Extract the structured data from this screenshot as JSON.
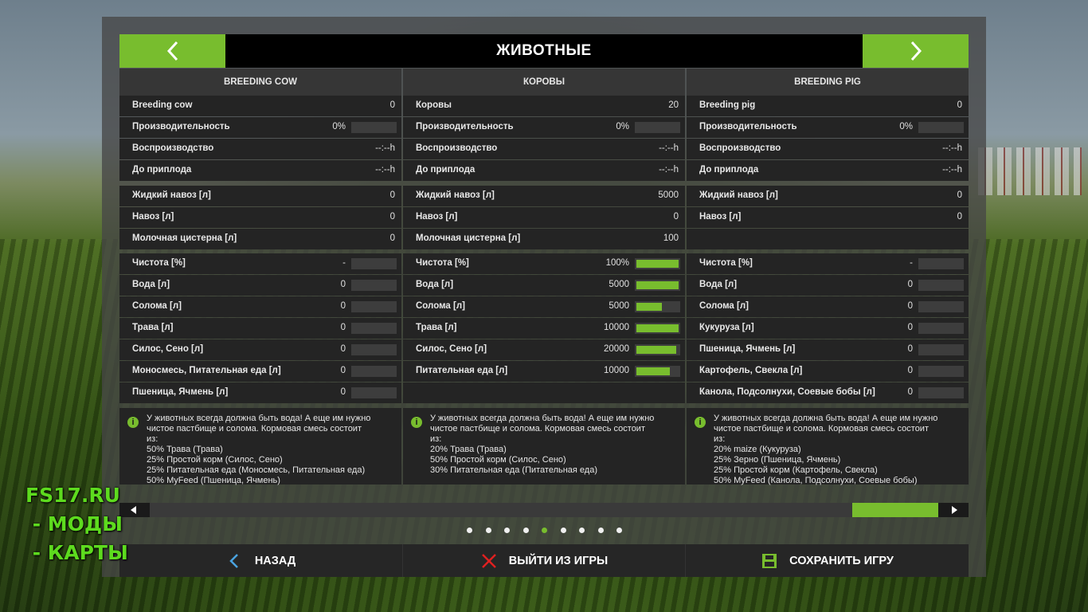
{
  "header": {
    "title": "ЖИВОТНЫЕ",
    "prev_icon": "chevron-left-icon",
    "next_icon": "chevron-right-icon"
  },
  "colors": {
    "accent": "#78bd2e",
    "panel_dark": "#242424",
    "header_bg": "#000000"
  },
  "columns": [
    {
      "title": "BREEDING COW",
      "rows": [
        {
          "label": "Breeding cow",
          "value": "0"
        },
        {
          "label": "Производительность",
          "value": "0%",
          "progress": 0
        },
        {
          "label": "Воспроизводство",
          "value": "--:--h"
        },
        {
          "label": "До приплода",
          "value": "--:--h"
        },
        {
          "label": "Жидкий навоз [л]",
          "value": "0"
        },
        {
          "label": "Навоз [л]",
          "value": "0"
        },
        {
          "label": "Молочная цистерна [л]",
          "value": "0"
        },
        {
          "label": "Чистота [%]",
          "value": "-",
          "progress": 0
        },
        {
          "label": "Вода [л]",
          "value": "0",
          "progress": 0
        },
        {
          "label": "Солома [л]",
          "value": "0",
          "progress": 0
        },
        {
          "label": "Трава [л]",
          "value": "0",
          "progress": 0
        },
        {
          "label": "Силос, Сено [л]",
          "value": "0",
          "progress": 0
        },
        {
          "label": "Моносмесь, Питательная еда [л]",
          "value": "0",
          "progress": 0
        },
        {
          "label": "Пшеница, Ячмень [л]",
          "value": "0",
          "progress": 0
        }
      ],
      "info": "У животных всегда должна быть вода! А еще им нужно\nчистое пастбище и солома. Кормовая смесь состоит\nиз:\n50% Трава (Трава)\n25% Простой корм (Силос, Сено)\n25% Питательная еда (Моносмесь, Питательная еда)\n50% MyFeed (Пшеница, Ячмень)"
    },
    {
      "title": "КОРОВЫ",
      "rows": [
        {
          "label": "Коровы",
          "value": "20"
        },
        {
          "label": "Производительность",
          "value": "0%",
          "progress": 0
        },
        {
          "label": "Воспроизводство",
          "value": "--:--h"
        },
        {
          "label": "До приплода",
          "value": "--:--h"
        },
        {
          "label": "Жидкий навоз [л]",
          "value": "5000"
        },
        {
          "label": "Навоз [л]",
          "value": "0"
        },
        {
          "label": "Молочная цистерна [л]",
          "value": "100"
        },
        {
          "label": "Чистота [%]",
          "value": "100%",
          "progress": 1.0
        },
        {
          "label": "Вода [л]",
          "value": "5000",
          "progress": 1.0
        },
        {
          "label": "Солома [л]",
          "value": "5000",
          "progress": 0.6
        },
        {
          "label": "Трава [л]",
          "value": "10000",
          "progress": 1.0
        },
        {
          "label": "Силос, Сено [л]",
          "value": "20000",
          "progress": 0.95
        },
        {
          "label": "Питательная еда [л]",
          "value": "10000",
          "progress": 0.8
        },
        {
          "label": "",
          "value": ""
        }
      ],
      "info": "У животных всегда должна быть вода! А еще им нужно\nчистое пастбище и солома. Кормовая смесь состоит\nиз:\n20% Трава (Трава)\n50% Простой корм (Силос, Сено)\n30% Питательная еда (Питательная еда)"
    },
    {
      "title": "BREEDING PIG",
      "rows": [
        {
          "label": "Breeding pig",
          "value": "0"
        },
        {
          "label": "Производительность",
          "value": "0%",
          "progress": 0
        },
        {
          "label": "Воспроизводство",
          "value": "--:--h"
        },
        {
          "label": "До приплода",
          "value": "--:--h"
        },
        {
          "label": "Жидкий навоз [л]",
          "value": "0"
        },
        {
          "label": "Навоз [л]",
          "value": "0"
        },
        {
          "label": "",
          "value": ""
        },
        {
          "label": "Чистота [%]",
          "value": "-",
          "progress": 0
        },
        {
          "label": "Вода [л]",
          "value": "0",
          "progress": 0
        },
        {
          "label": "Солома [л]",
          "value": "0",
          "progress": 0
        },
        {
          "label": "Кукуруза [л]",
          "value": "0",
          "progress": 0
        },
        {
          "label": "Пшеница, Ячмень [л]",
          "value": "0",
          "progress": 0
        },
        {
          "label": "Картофель, Свекла [л]",
          "value": "0",
          "progress": 0
        },
        {
          "label": "Канола, Подсолнухи, Соевые бобы [л]",
          "value": "0",
          "progress": 0
        }
      ],
      "info": "У животных всегда должна быть вода! А еще им нужно\nчистое пастбище и солома. Кормовая смесь состоит\nиз:\n20% maize (Кукуруза)\n25% Зерно (Пшеница, Ячмень)\n25% Простой корм (Картофель, Свекла)\n50% MyFeed (Канола, Подсолнухи, Соевые бобы)"
    }
  ],
  "scrollbar": {
    "position": 1.0,
    "left_icon": "triangle-left-icon",
    "right_icon": "triangle-right-icon"
  },
  "pagination": {
    "count": 9,
    "active_index": 4
  },
  "footer": {
    "back_label": "НАЗАД",
    "back_icon": "chevron-left-icon",
    "quit_label": "ВЫЙТИ ИЗ ИГРЫ",
    "quit_icon": "close-icon",
    "save_label": "СОХРАНИТЬ ИГРУ",
    "save_icon": "save-icon"
  },
  "watermark": {
    "line1": "FS17.RU",
    "line2": " - МОДЫ",
    "line3": " - КАРТЫ"
  }
}
